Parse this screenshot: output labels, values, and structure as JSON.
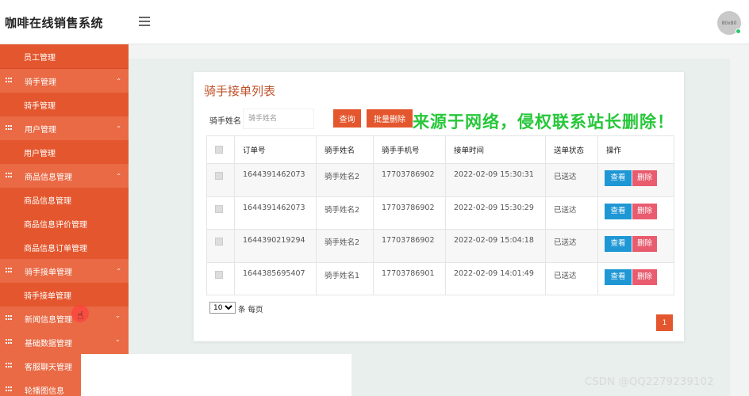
{
  "app": {
    "title": "咖啡在线销售系统",
    "avatar_text": "80x80"
  },
  "sidebar": {
    "top_item": "员工管理",
    "groups": [
      {
        "label": "骑手管理",
        "chevron": "‹",
        "children": [
          "骑手管理"
        ]
      },
      {
        "label": "用户管理",
        "chevron": "‹",
        "children": [
          "用户管理"
        ]
      },
      {
        "label": "商品信息管理",
        "chevron": "‹",
        "children": [
          "商品信息管理",
          "商品信息评价管理",
          "商品信息订单管理"
        ]
      },
      {
        "label": "骑手接单管理",
        "chevron": "‹",
        "children": [
          "骑手接单管理"
        ]
      },
      {
        "label": "新闻信息管理",
        "chevron": "‹",
        "children": []
      },
      {
        "label": "基础数据管理",
        "chevron": "‹",
        "children": []
      },
      {
        "label": "客服聊天管理",
        "chevron": "‹",
        "children": []
      },
      {
        "label": "轮播图信息",
        "chevron": "‹",
        "children": []
      }
    ]
  },
  "page": {
    "title": "骑手接单列表"
  },
  "search": {
    "label": "骑手姓名",
    "placeholder": "骑手姓名",
    "query_button": "查询",
    "batch_delete_button": "批量删除"
  },
  "table": {
    "headers": [
      "订单号",
      "骑手姓名",
      "骑手手机号",
      "接单时间",
      "送单状态",
      "操作"
    ],
    "rows": [
      {
        "order_no": "1644391462073",
        "rider_name": "骑手姓名2",
        "rider_phone": "17703786902",
        "time": "2022-02-09 15:30:31",
        "status": "已送达"
      },
      {
        "order_no": "1644391462073",
        "rider_name": "骑手姓名2",
        "rider_phone": "17703786902",
        "time": "2022-02-09 15:30:29",
        "status": "已送达"
      },
      {
        "order_no": "1644390219294",
        "rider_name": "骑手姓名2",
        "rider_phone": "17703786902",
        "time": "2022-02-09 15:04:18",
        "status": "已送达"
      },
      {
        "order_no": "1644385695407",
        "rider_name": "骑手姓名1",
        "rider_phone": "17703786901",
        "time": "2022-02-09 14:01:49",
        "status": "已送达"
      }
    ],
    "view_label": "查看",
    "delete_label": "删除"
  },
  "pagination": {
    "page_size": "10",
    "page_size_label": "条 每页",
    "current_page": "1"
  },
  "overlays": {
    "watermark": "来源于网络，侵权联系站长删除！",
    "csdn": "CSDN @QQ2279239102"
  },
  "colors": {
    "accent": "#e4572e",
    "view_button": "#1f97d4",
    "delete_button": "#e95c6f",
    "watermark": "#27c73a"
  }
}
